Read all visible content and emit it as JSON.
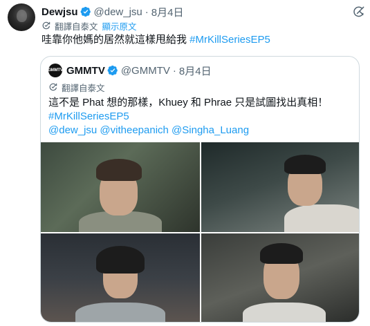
{
  "tweet": {
    "author_name": "Dewjsu",
    "handle": "@dew_jsu",
    "separator": "·",
    "date": "8月4日",
    "translate_label": "翻譯自泰文",
    "show_original_label": "顯示原文",
    "text": "哇靠你他媽的居然就這樣甩給我 ",
    "hashtag": "#MrKillSeriesEP5"
  },
  "quoted_tweet": {
    "avatar_label": "GMMTV",
    "author_name": "GMMTV",
    "handle": "@GMMTV",
    "separator": "·",
    "date": "8月4日",
    "translate_label": "翻譯自泰文",
    "lines": [
      "這不是 Phat 想的那樣，Khuey 和 Phrae 只是試圖找出真相！",
      "#MrKillSeriesEP5",
      "@dew_jsu @vitheepanich @Singha_Luang"
    ]
  },
  "icons": {
    "verified": "verified-badge-icon",
    "translate": "translate-icon",
    "more": "grok-icon"
  },
  "colors": {
    "link": "#1d9bf0",
    "secondary_text": "#536471",
    "border": "#cfd9de"
  }
}
